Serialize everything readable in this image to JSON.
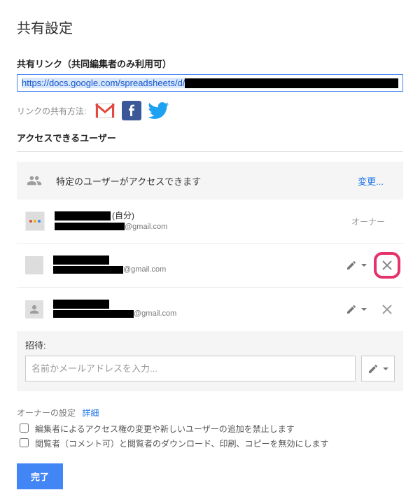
{
  "title": "共有設定",
  "share_link": {
    "label": "共有リンク（共同編集者のみ利用可）",
    "prefix": "https://docs.google.com/spreadsheets/d/",
    "share_via_label": "リンクの共有方法:"
  },
  "access": {
    "heading": "アクセスできるユーザー",
    "summary": "特定のユーザーがアクセスできます",
    "change_label": "変更...",
    "users": [
      {
        "self_suffix": "(自分)",
        "email_domain": "@gmail.com",
        "role": "owner",
        "role_label": "オーナー"
      },
      {
        "email_domain": "@gmail.com",
        "role": "editor",
        "removable": true,
        "highlighted": true
      },
      {
        "email_domain": "@gmail.com",
        "role": "editor",
        "removable": true,
        "highlighted": false
      }
    ]
  },
  "invite": {
    "label": "招待:",
    "placeholder": "名前かメールアドレスを入力..."
  },
  "owner_settings": {
    "heading": "オーナーの設定",
    "details_label": "詳細",
    "option1": "編集者によるアクセス権の変更や新しいユーザーの追加を禁止します",
    "option2": "閲覧者（コメント可）と閲覧者のダウンロード、印刷、コピーを無効にします"
  },
  "done_label": "完了"
}
